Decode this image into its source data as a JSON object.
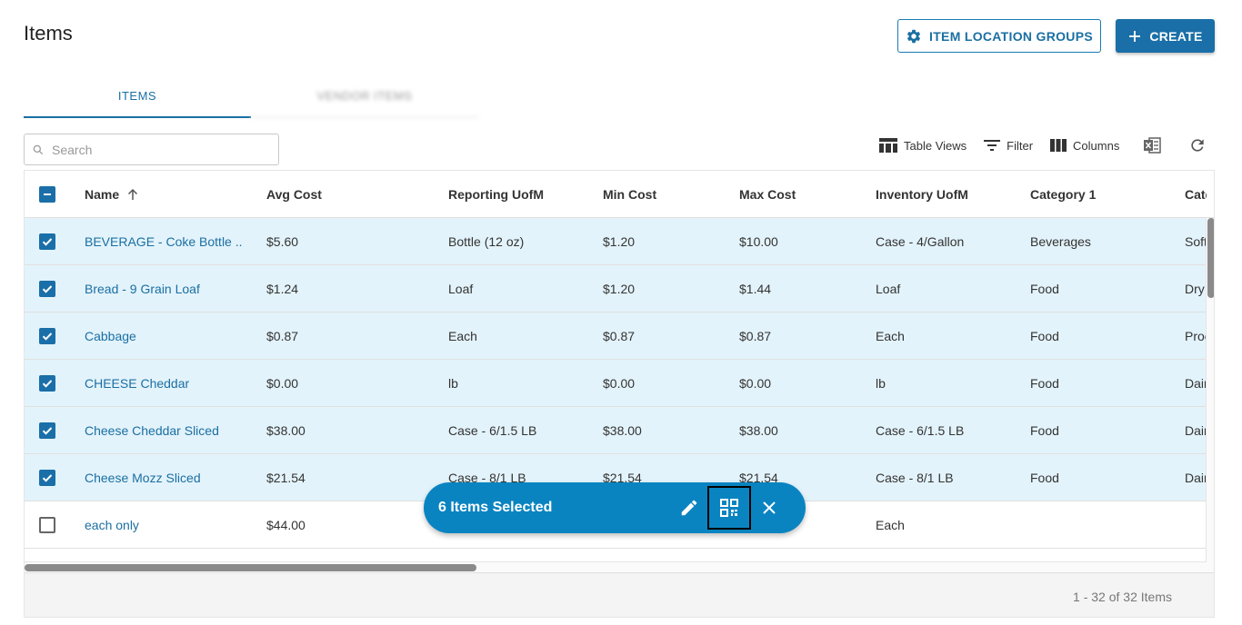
{
  "page": {
    "title": "Items"
  },
  "buttons": {
    "item_location_groups": "ITEM LOCATION GROUPS",
    "create": "CREATE"
  },
  "tabs": [
    {
      "label": "ITEMS",
      "active": true
    },
    {
      "label": "VENDOR ITEMS",
      "active": false
    }
  ],
  "search": {
    "placeholder": "Search"
  },
  "toolbar": {
    "table_views": "Table Views",
    "filter": "Filter",
    "columns": "Columns"
  },
  "columns": [
    "Name",
    "Avg Cost",
    "Reporting UofM",
    "Min Cost",
    "Max Cost",
    "Inventory UofM",
    "Category 1",
    "Cate"
  ],
  "rows": [
    {
      "selected": true,
      "cells": [
        "BEVERAGE - Coke Bottle ...",
        "$5.60",
        "Bottle (12 oz)",
        "$1.20",
        "$10.00",
        "Case - 4/Gallon",
        "Beverages",
        "Soft"
      ]
    },
    {
      "selected": true,
      "cells": [
        "Bread - 9 Grain Loaf",
        "$1.24",
        "Loaf",
        "$1.20",
        "$1.44",
        "Loaf",
        "Food",
        "Dry"
      ]
    },
    {
      "selected": true,
      "cells": [
        "Cabbage",
        "$0.87",
        "Each",
        "$0.87",
        "$0.87",
        "Each",
        "Food",
        "Proc"
      ]
    },
    {
      "selected": true,
      "cells": [
        "CHEESE Cheddar",
        "$0.00",
        "lb",
        "$0.00",
        "$0.00",
        "lb",
        "Food",
        "Dair"
      ]
    },
    {
      "selected": true,
      "cells": [
        "Cheese Cheddar Sliced",
        "$38.00",
        "Case - 6/1.5 LB",
        "$38.00",
        "$38.00",
        "Case - 6/1.5 LB",
        "Food",
        "Dair"
      ]
    },
    {
      "selected": true,
      "cells": [
        "Cheese Mozz Sliced",
        "$21.54",
        "Case - 8/1 LB",
        "$21.54",
        "$21.54",
        "Case - 8/1 LB",
        "Food",
        "Dair"
      ]
    },
    {
      "selected": false,
      "cells": [
        "each only",
        "$44.00",
        "",
        "",
        "",
        "Each",
        "",
        ""
      ]
    }
  ],
  "pagination": {
    "text": "1 - 32 of 32 Items"
  },
  "selection_bar": {
    "text": "6 Items Selected"
  },
  "colors": {
    "accent": "#1a6fa3",
    "selection_bar": "#0a84c1",
    "selected_row": "#e3f3fb"
  }
}
